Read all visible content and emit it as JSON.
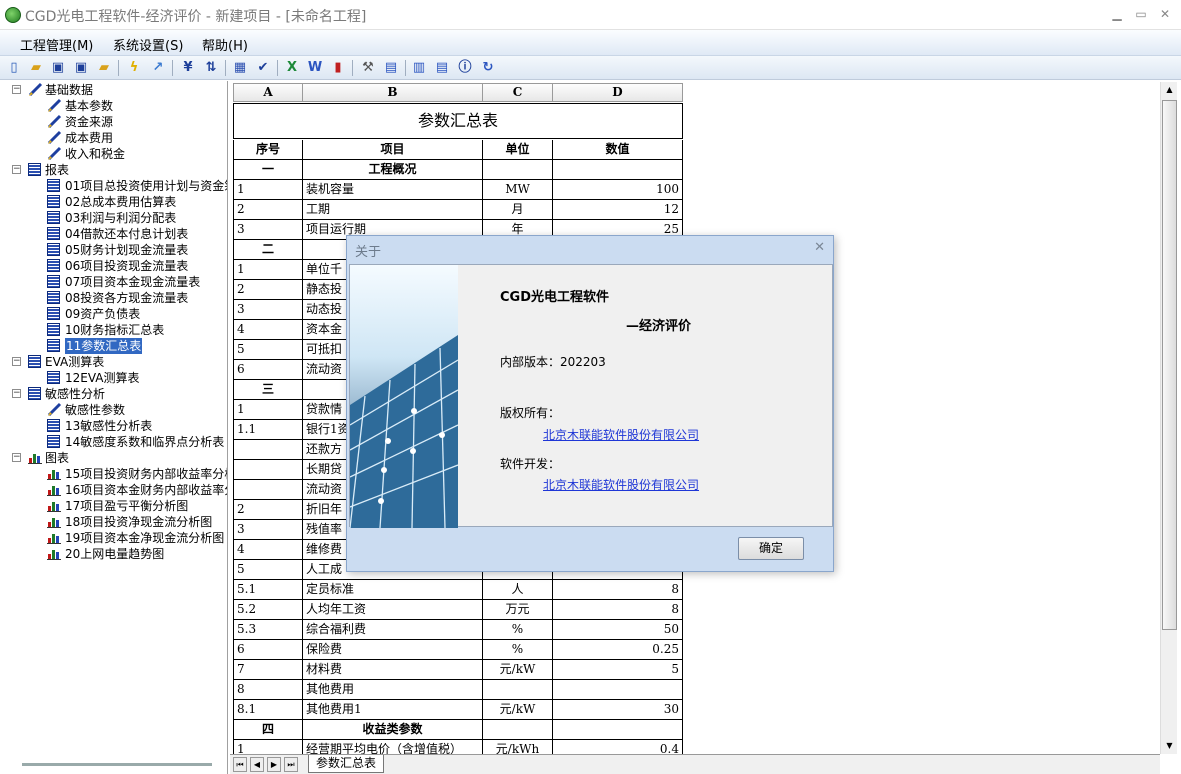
{
  "window": {
    "title": "CGD光电工程软件-经济评价 - 新建项目 - [未命名工程]"
  },
  "menu": [
    "工程管理(M)",
    "系统设置(S)",
    "帮助(H)"
  ],
  "tree": {
    "groups": [
      {
        "label": "基础数据",
        "icon": "pen-icon",
        "items": [
          {
            "label": "基本参数",
            "icon": "pen-icon"
          },
          {
            "label": "资金来源",
            "icon": "pen-icon"
          },
          {
            "label": "成本费用",
            "icon": "pen-icon"
          },
          {
            "label": "收入和税金",
            "icon": "pen-icon"
          }
        ]
      },
      {
        "label": "报表",
        "icon": "table-icon",
        "items": [
          {
            "label": "01项目总投资使用计划与资金筹",
            "icon": "table-icon"
          },
          {
            "label": "02总成本费用估算表",
            "icon": "table-icon"
          },
          {
            "label": "03利润与利润分配表",
            "icon": "table-icon"
          },
          {
            "label": "04借款还本付息计划表",
            "icon": "table-icon"
          },
          {
            "label": "05财务计划现金流量表",
            "icon": "table-icon"
          },
          {
            "label": "06项目投资现金流量表",
            "icon": "table-icon"
          },
          {
            "label": "07项目资本金现金流量表",
            "icon": "table-icon"
          },
          {
            "label": "08投资各方现金流量表",
            "icon": "table-icon"
          },
          {
            "label": "09资产负债表",
            "icon": "table-icon"
          },
          {
            "label": "10财务指标汇总表",
            "icon": "table-icon"
          },
          {
            "label": "11参数汇总表",
            "icon": "table-icon",
            "selected": true
          }
        ]
      },
      {
        "label": "EVA测算表",
        "icon": "table-icon",
        "items": [
          {
            "label": "12EVA测算表",
            "icon": "table-icon"
          }
        ]
      },
      {
        "label": "敏感性分析",
        "icon": "table-icon",
        "items": [
          {
            "label": "敏感性参数",
            "icon": "pen-icon"
          },
          {
            "label": "13敏感性分析表",
            "icon": "table-icon"
          },
          {
            "label": "14敏感度系数和临界点分析表",
            "icon": "table-icon"
          }
        ]
      },
      {
        "label": "图表",
        "icon": "chart-icon",
        "items": [
          {
            "label": "15项目投资财务内部收益率分析",
            "icon": "chart-icon"
          },
          {
            "label": "16项目资本金财务内部收益率分",
            "icon": "chart-icon"
          },
          {
            "label": "17项目盈亏平衡分析图",
            "icon": "chart-icon"
          },
          {
            "label": "18项目投资净现金流分析图",
            "icon": "chart-icon"
          },
          {
            "label": "19项目资本金净现金流分析图",
            "icon": "chart-icon"
          },
          {
            "label": "20上网电量趋势图",
            "icon": "chart-icon"
          }
        ]
      }
    ]
  },
  "sheet": {
    "columns": [
      "A",
      "B",
      "C",
      "D"
    ],
    "title": "参数汇总表",
    "header": [
      "序号",
      "项目",
      "单位",
      "数值"
    ],
    "rows": [
      [
        "一",
        "工程概况",
        "",
        "",
        "section"
      ],
      [
        "1",
        "装机容量",
        "MW",
        "100",
        ""
      ],
      [
        "2",
        "工期",
        "月",
        "12",
        ""
      ],
      [
        "3",
        "项目运行期",
        "年",
        "25",
        ""
      ],
      [
        "二",
        "",
        "",
        "",
        "section"
      ],
      [
        "1",
        "单位千",
        "",
        "",
        ""
      ],
      [
        "2",
        "静态投",
        "",
        "",
        ""
      ],
      [
        "3",
        "动态投",
        "",
        "",
        ""
      ],
      [
        "4",
        "资本金",
        "",
        "",
        ""
      ],
      [
        "5",
        "可抵扣",
        "",
        "",
        ""
      ],
      [
        "6",
        "流动资",
        "",
        "",
        ""
      ],
      [
        "三",
        "",
        "",
        "",
        "section"
      ],
      [
        "1",
        "贷款情",
        "",
        "",
        ""
      ],
      [
        "1.1",
        "银行1资",
        "",
        "",
        ""
      ],
      [
        "",
        "还款方",
        "",
        "",
        ""
      ],
      [
        "",
        "长期贷",
        "",
        "",
        ""
      ],
      [
        "",
        "流动资",
        "",
        "",
        ""
      ],
      [
        "2",
        "折旧年",
        "",
        "",
        ""
      ],
      [
        "3",
        "残值率",
        "",
        "",
        ""
      ],
      [
        "4",
        "维修费",
        "",
        "",
        ""
      ],
      [
        "5",
        "人工成",
        "",
        "",
        ""
      ],
      [
        "5.1",
        "定员标准",
        "人",
        "8",
        ""
      ],
      [
        "5.2",
        "人均年工资",
        "万元",
        "8",
        ""
      ],
      [
        "5.3",
        "综合福利费",
        "%",
        "50",
        ""
      ],
      [
        "6",
        "保险费",
        "%",
        "0.25",
        ""
      ],
      [
        "7",
        "材料费",
        "元/kW",
        "5",
        ""
      ],
      [
        "8",
        "其他费用",
        "",
        "",
        ""
      ],
      [
        "8.1",
        "其他费用1",
        "元/kW",
        "30",
        ""
      ],
      [
        "四",
        "收益类参数",
        "",
        "",
        "section"
      ],
      [
        "1",
        "经营期平均电价（含增值税）",
        "元/kWh",
        "0.4",
        ""
      ]
    ],
    "tab": "参数汇总表"
  },
  "dialog": {
    "title": "关于",
    "product": "CGD光电工程软件",
    "subtitle": "—经济评价",
    "version": "内部版本：202203",
    "copyright_label": "版权所有：",
    "copyright_link": "北京木联能软件股份有限公司",
    "dev_label": "软件开发：",
    "dev_link": "北京木联能软件股份有限公司",
    "ok": "确定"
  }
}
